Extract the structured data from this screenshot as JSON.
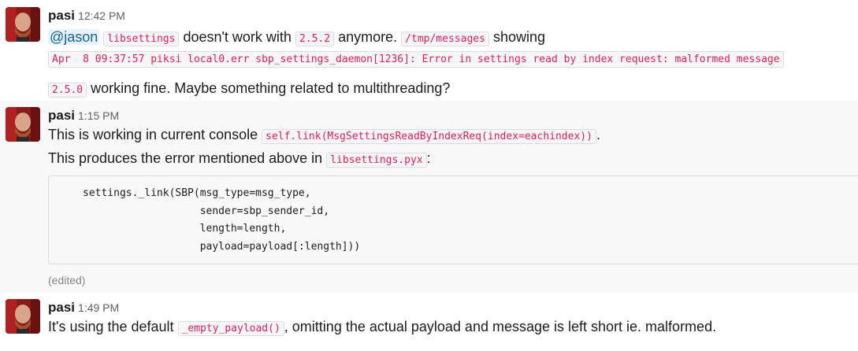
{
  "messages": [
    {
      "author": "pasi",
      "time": "12:42 PM",
      "line1": {
        "mention": "@jason",
        "code_lib": "libsettings",
        "t1": "doesn't work with",
        "code_ver": "2.5.2",
        "t2": "anymore.",
        "code_path": "/tmp/messages",
        "t3": "showing"
      },
      "error_line": "Apr  8 09:37:57 piksi local0.err sbp_settings_daemon[1236]: Error in settings read by index request: malformed message",
      "line2": {
        "code_ver": "2.5.0",
        "t1": "working fine. Maybe something related to multithreading?"
      }
    },
    {
      "author": "pasi",
      "time": "1:15 PM",
      "line1": {
        "t1": "This is working in current console",
        "code": "self.link(MsgSettingsReadByIndexReq(index=eachindex))",
        "t2": "."
      },
      "line2": {
        "t1": "This produces the error mentioned above in",
        "code": "libsettings.pyx",
        "t2": ":"
      },
      "code_block": [
        "settings._link(SBP(msg_type=msg_type,",
        "                   sender=sbp_sender_id,",
        "                   length=length,",
        "                   payload=payload[:length]))"
      ],
      "edited": "(edited)"
    },
    {
      "author": "pasi",
      "time": "1:49 PM",
      "line1": {
        "t1": "It's using the default",
        "code": "_empty_payload()",
        "t2": ", omitting the actual payload and message is left short ie. malformed."
      }
    }
  ],
  "colors": {
    "code_text": "#e01e5a",
    "mention": "#1264a3",
    "hover_bg": "#f8f8f8"
  }
}
